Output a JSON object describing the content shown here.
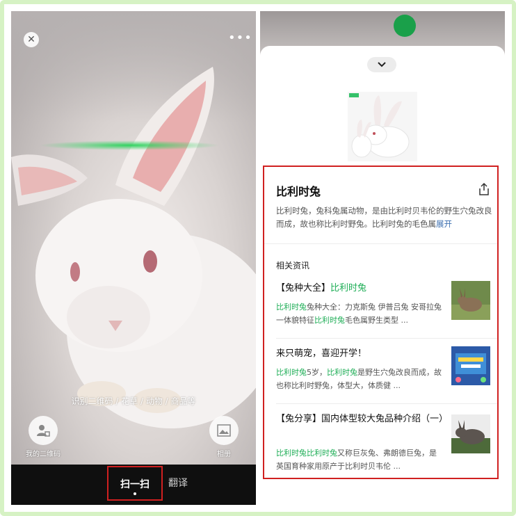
{
  "scanner": {
    "hint": "识别二维码 / 花草 / 动物 / 商品等",
    "my_qr_label": "我的二维码",
    "album_label": "相册",
    "tab_scan": "扫一扫",
    "tab_translate": "翻译"
  },
  "result": {
    "title": "比利时兔",
    "description_main": "比利时兔，兔科兔属动物，是由比利时贝韦伦的野生穴兔改良而成，故也称比利时野兔。比利时兔的毛色属",
    "description_more": "展开",
    "section_label": "相关资讯",
    "news": [
      {
        "title_prefix": "【兔种大全】",
        "title_highlight": "比利时兔",
        "title_suffix": "",
        "snippet_parts": [
          {
            "text": "比利时兔",
            "hl": true
          },
          {
            "text": "兔种大全：力克斯兔 伊普吕兔 安哥拉兔一体貌特征",
            "hl": false
          },
          {
            "text": "比利时兔",
            "hl": true
          },
          {
            "text": "毛色属野生类型 ...",
            "hl": false
          }
        ]
      },
      {
        "title_prefix": "来只萌宠，喜迎开学！",
        "title_highlight": "",
        "title_suffix": "",
        "snippet_parts": [
          {
            "text": "比利时兔",
            "hl": true
          },
          {
            "text": "5岁，",
            "hl": false
          },
          {
            "text": "比利时兔",
            "hl": true
          },
          {
            "text": "是野生穴兔改良而成，故也称比利时野兔，体型大，体质健 ...",
            "hl": false
          }
        ]
      },
      {
        "title_prefix": "【兔分享】国内体型较大兔品种介绍（一）",
        "title_highlight": "",
        "title_suffix": "",
        "snippet_parts": [
          {
            "text": "比利时兔比利时兔",
            "hl": true
          },
          {
            "text": "又称巨灰兔、弗朗德巨兔，是英国育种家用原产于比利时贝韦伦 ...",
            "hl": false
          }
        ]
      }
    ]
  },
  "colors": {
    "highlight_green": "#1fae57",
    "annotation_red": "#d02020",
    "link_blue": "#3c6fb0"
  }
}
